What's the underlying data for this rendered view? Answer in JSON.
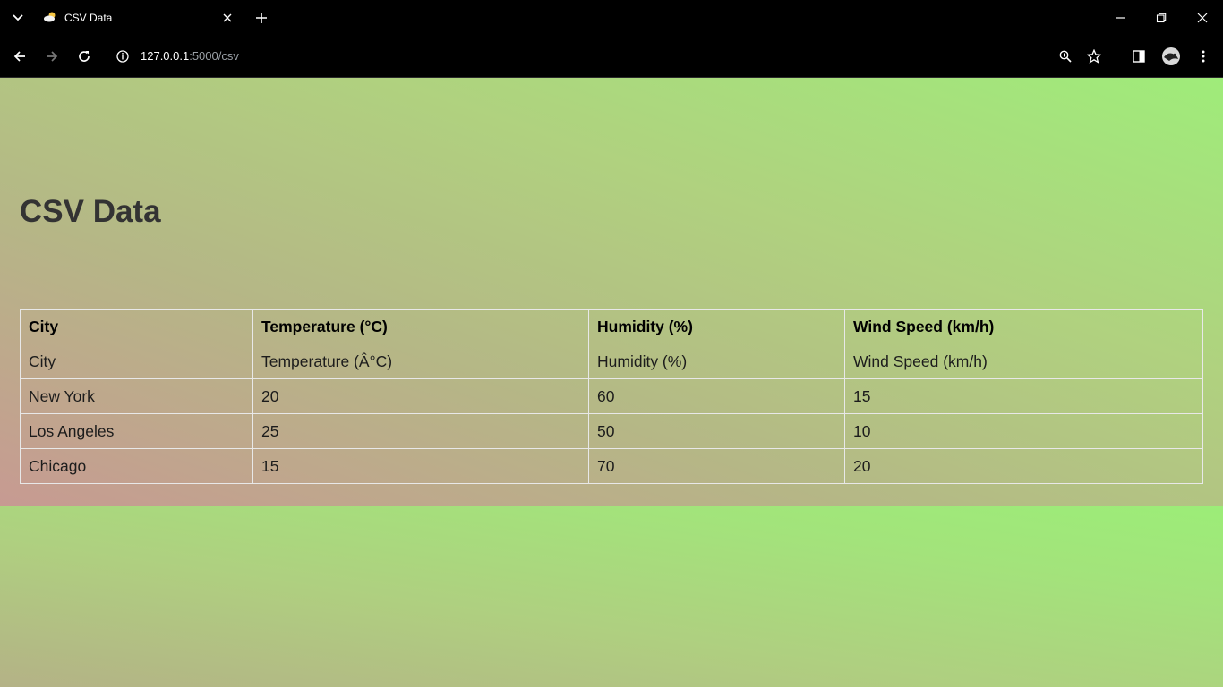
{
  "browser": {
    "tab": {
      "title": "CSV Data",
      "favicon": "weather-cloud-sun-icon"
    },
    "address": {
      "host": "127.0.0.1",
      "rest": ":5000/csv"
    }
  },
  "page": {
    "heading": "CSV Data",
    "table": {
      "headers": [
        "City",
        "Temperature (°C)",
        "Humidity (%)",
        "Wind Speed (km/h)"
      ],
      "rows": [
        [
          "City",
          "Temperature (Â°C)",
          "Humidity (%)",
          "Wind Speed (km/h)"
        ],
        [
          "New York",
          "20",
          "60",
          "15"
        ],
        [
          "Los Angeles",
          "25",
          "50",
          "10"
        ],
        [
          "Chicago",
          "15",
          "70",
          "20"
        ]
      ]
    }
  },
  "colors": {
    "chrome_bg": "#000000",
    "heading_text": "#333333",
    "gradient_start": "#c79a92",
    "gradient_end": "#9fec7a"
  }
}
